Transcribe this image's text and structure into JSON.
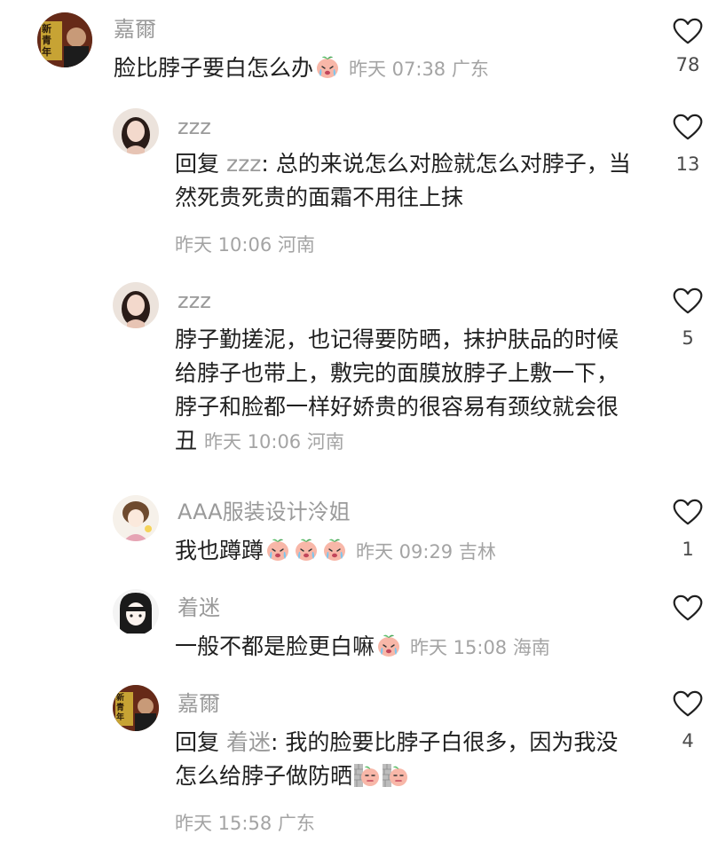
{
  "comments": [
    {
      "username": "嘉爾",
      "text": "脸比脖子要白怎么办",
      "emoji": [
        "crying-peach"
      ],
      "time": "昨天 07:38",
      "location": "广东",
      "likes": "78",
      "avatar_text": "新青年"
    },
    {
      "username": "zzz",
      "reply_prefix": "回复 ",
      "reply_to": "zzz",
      "reply_colon": ": ",
      "text": "总的来说怎么对脸就怎么对脖子，当然死贵死贵的面霜不用往上抹",
      "time": "昨天 10:06",
      "location": "河南",
      "likes": "13"
    },
    {
      "username": "zzz",
      "text": "脖子勤搓泥，也记得要防晒，抹护肤品的时候给脖子也带上，敷完的面膜放脖子上敷一下，脖子和脸都一样好娇贵的很容易有颈纹就会很丑",
      "time": "昨天 10:06",
      "location": "河南",
      "likes": "5"
    },
    {
      "username": "AAA服装设计泠姐",
      "text": "我也蹲蹲",
      "emoji": [
        "crying-peach",
        "crying-peach",
        "crying-peach"
      ],
      "time": "昨天 09:29",
      "location": "吉林",
      "likes": "1"
    },
    {
      "username": "着迷",
      "text": "一般不都是脸更白嘛",
      "emoji": [
        "crying-peach"
      ],
      "time": "昨天 15:08",
      "location": "海南",
      "likes": ""
    },
    {
      "username": "嘉爾",
      "reply_prefix": "回复 ",
      "reply_to": "着迷",
      "reply_colon": ": ",
      "text": "我的脸要比脖子白很多，因为我没怎么给脖子做防晒",
      "emoji": [
        "wall-peach",
        "wall-peach"
      ],
      "time": "昨天 15:58",
      "location": "广东",
      "likes": "4",
      "avatar_text": "新青年"
    }
  ],
  "colors": {
    "username": "#9a9a9a",
    "meta": "#a4a4a4",
    "body": "#1f1f1f",
    "like_outline": "#1f1f1f"
  }
}
